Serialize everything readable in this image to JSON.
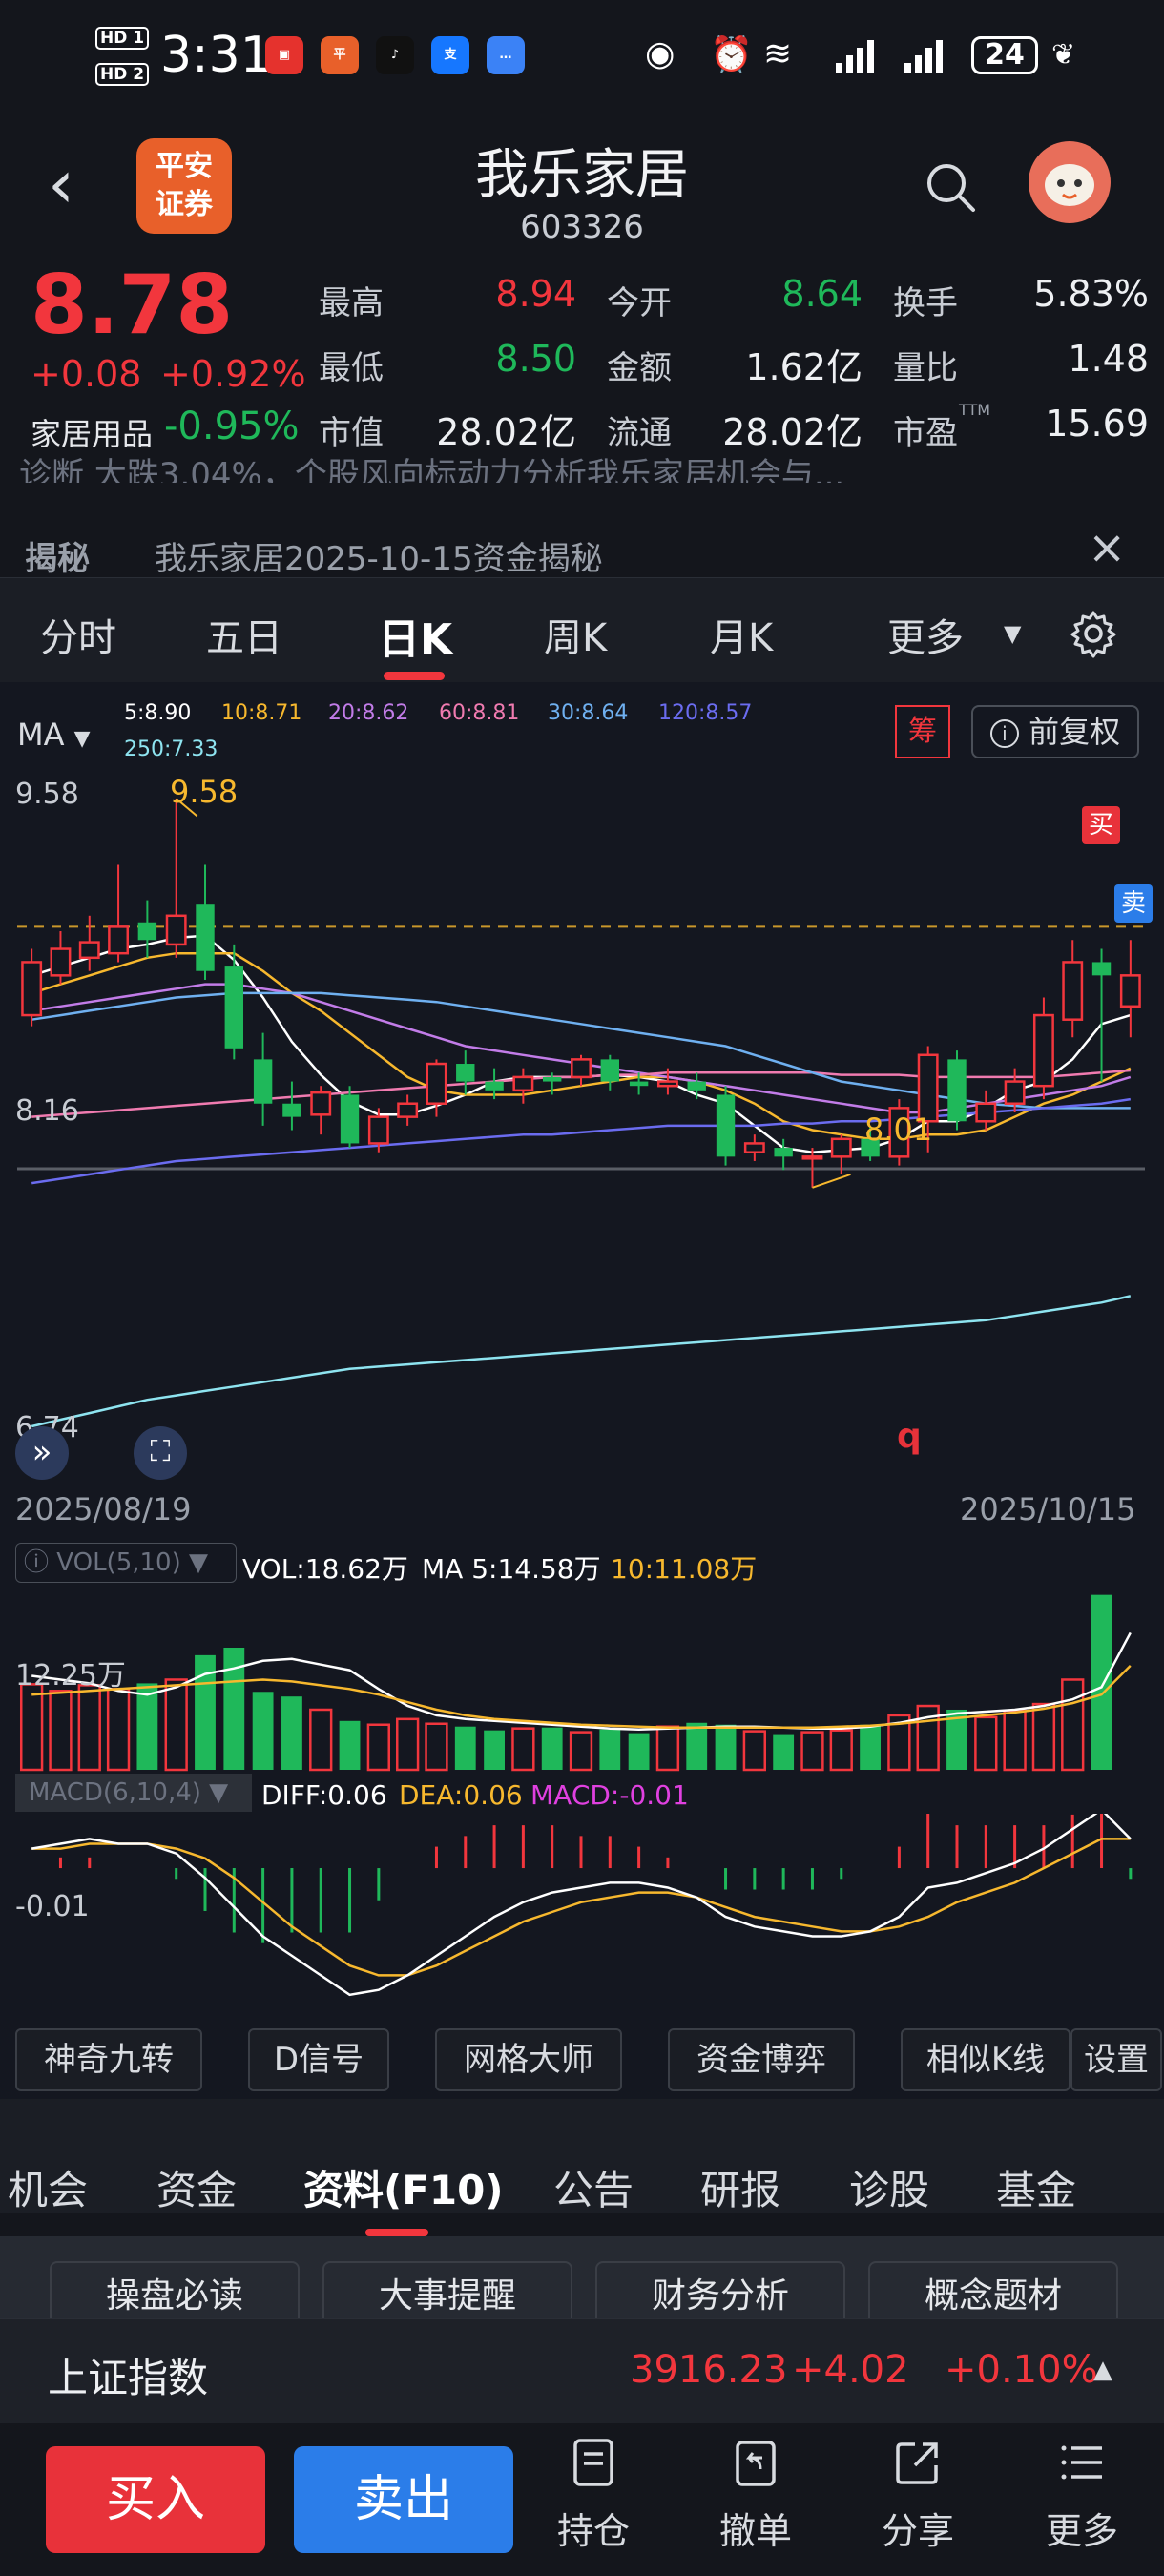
{
  "status": {
    "time": "3:31",
    "battery": "24",
    "hd1": "HD 1",
    "hd2": "HD 2",
    "app_icons": [
      "huawei-store-icon",
      "pingan-app-icon",
      "douyin-icon",
      "alipay-icon",
      "message-icon"
    ],
    "sys_icons": [
      "eye-icon",
      "alarm-icon",
      "wifi-icon",
      "signal-icon",
      "signal-icon",
      "leaf-icon"
    ]
  },
  "header": {
    "logo": "平安\n证券",
    "name": "我乐家居",
    "code": "603326"
  },
  "quote": {
    "price": "8.78",
    "change": "+0.08",
    "change_pct": "+0.92%",
    "industry": "家居用品",
    "industry_pct": "-0.95%",
    "fields": [
      {
        "label": "最高",
        "value": "8.94",
        "color": "red"
      },
      {
        "label": "今开",
        "value": "8.64",
        "color": "green"
      },
      {
        "label": "换手",
        "value": "5.83%",
        "color": "white"
      },
      {
        "label": "最低",
        "value": "8.50",
        "color": "green"
      },
      {
        "label": "金额",
        "value": "1.62亿",
        "color": "white"
      },
      {
        "label": "量比",
        "value": "1.48",
        "color": "white"
      },
      {
        "label": "市值",
        "value": "28.02亿",
        "color": "white"
      },
      {
        "label": "流通",
        "value": "28.02亿",
        "color": "white"
      },
      {
        "label": "市盈",
        "value": "15.69",
        "color": "white"
      }
    ],
    "ttm": "TTM"
  },
  "ticker": "诊断    大跌3.04%，个股风向标动力分析我乐家居机会与...",
  "notice": {
    "tag": "揭秘",
    "text": "我乐家居2025-10-15资金揭秘"
  },
  "tabs": {
    "items": [
      "分时",
      "五日",
      "日K",
      "周K",
      "月K",
      "更多"
    ],
    "active": "日K"
  },
  "ma": {
    "selector": "MA",
    "items": [
      {
        "label": "5:8.90",
        "color": "#ffffff"
      },
      {
        "label": "10:8.71",
        "color": "#f7b82e"
      },
      {
        "label": "20:8.62",
        "color": "#c27ce8"
      },
      {
        "label": "60:8.81",
        "color": "#f07bb0"
      },
      {
        "label": "30:8.64",
        "color": "#6fb0f0"
      },
      {
        "label": "120:8.57",
        "color": "#6b6cf0"
      },
      {
        "label": "250:7.33",
        "color": "#8ee4f0"
      }
    ],
    "chou": "筹",
    "fuquan": "前复权"
  },
  "kline": {
    "y_top": "9.58",
    "y_mid": "8.16",
    "y_low": "6.74",
    "high_label": "9.58",
    "low_label": "8.01",
    "buy_tag": "买",
    "sell_tag": "卖",
    "q": "q",
    "date_start": "2025/08/19",
    "date_end": "2025/10/15"
  },
  "chart_data": {
    "type": "candlestick",
    "candles": [
      {
        "o": 8.6,
        "c": 8.84,
        "h": 8.9,
        "l": 8.55
      },
      {
        "o": 8.78,
        "c": 8.9,
        "h": 8.98,
        "l": 8.74
      },
      {
        "o": 8.86,
        "c": 8.93,
        "h": 9.05,
        "l": 8.8
      },
      {
        "o": 8.88,
        "c": 9.0,
        "h": 9.28,
        "l": 8.84
      },
      {
        "o": 9.02,
        "c": 8.94,
        "h": 9.12,
        "l": 8.86
      },
      {
        "o": 8.92,
        "c": 9.05,
        "h": 9.58,
        "l": 8.86
      },
      {
        "o": 9.1,
        "c": 8.8,
        "h": 9.28,
        "l": 8.76
      },
      {
        "o": 8.82,
        "c": 8.45,
        "h": 8.92,
        "l": 8.4
      },
      {
        "o": 8.4,
        "c": 8.2,
        "h": 8.52,
        "l": 8.1
      },
      {
        "o": 8.2,
        "c": 8.14,
        "h": 8.3,
        "l": 8.08
      },
      {
        "o": 8.15,
        "c": 8.25,
        "h": 8.28,
        "l": 8.06
      },
      {
        "o": 8.24,
        "c": 8.02,
        "h": 8.28,
        "l": 8.0
      },
      {
        "o": 8.02,
        "c": 8.14,
        "h": 8.18,
        "l": 7.98
      },
      {
        "o": 8.14,
        "c": 8.2,
        "h": 8.24,
        "l": 8.1
      },
      {
        "o": 8.2,
        "c": 8.38,
        "h": 8.4,
        "l": 8.14
      },
      {
        "o": 8.38,
        "c": 8.3,
        "h": 8.44,
        "l": 8.24
      },
      {
        "o": 8.3,
        "c": 8.26,
        "h": 8.36,
        "l": 8.22
      },
      {
        "o": 8.26,
        "c": 8.32,
        "h": 8.36,
        "l": 8.2
      },
      {
        "o": 8.32,
        "c": 8.3,
        "h": 8.34,
        "l": 8.24
      },
      {
        "o": 8.32,
        "c": 8.4,
        "h": 8.42,
        "l": 8.28
      },
      {
        "o": 8.4,
        "c": 8.3,
        "h": 8.42,
        "l": 8.26
      },
      {
        "o": 8.3,
        "c": 8.28,
        "h": 8.34,
        "l": 8.24
      },
      {
        "o": 8.28,
        "c": 8.3,
        "h": 8.36,
        "l": 8.24
      },
      {
        "o": 8.3,
        "c": 8.26,
        "h": 8.34,
        "l": 8.22
      },
      {
        "o": 8.24,
        "c": 7.96,
        "h": 8.28,
        "l": 7.92
      },
      {
        "o": 7.98,
        "c": 8.02,
        "h": 8.06,
        "l": 7.94
      },
      {
        "o": 8.0,
        "c": 7.96,
        "h": 8.04,
        "l": 7.9
      },
      {
        "o": 7.96,
        "c": 7.96,
        "h": 8.0,
        "l": 7.82
      },
      {
        "o": 7.96,
        "c": 8.04,
        "h": 8.06,
        "l": 7.88
      },
      {
        "o": 8.04,
        "c": 7.96,
        "h": 8.1,
        "l": 7.94
      },
      {
        "o": 7.96,
        "c": 8.18,
        "h": 8.22,
        "l": 7.92
      },
      {
        "o": 8.12,
        "c": 8.42,
        "h": 8.46,
        "l": 7.98
      },
      {
        "o": 8.4,
        "c": 8.12,
        "h": 8.44,
        "l": 8.08
      },
      {
        "o": 8.12,
        "c": 8.2,
        "h": 8.26,
        "l": 8.08
      },
      {
        "o": 8.2,
        "c": 8.3,
        "h": 8.36,
        "l": 8.16
      },
      {
        "o": 8.28,
        "c": 8.6,
        "h": 8.68,
        "l": 8.22
      },
      {
        "o": 8.58,
        "c": 8.84,
        "h": 8.94,
        "l": 8.5
      },
      {
        "o": 8.84,
        "c": 8.78,
        "h": 8.9,
        "l": 8.3
      },
      {
        "o": 8.64,
        "c": 8.78,
        "h": 8.94,
        "l": 8.5
      }
    ],
    "ma_series": [
      {
        "name": "MA5",
        "color": "#ffffff",
        "values": [
          8.78,
          8.82,
          8.86,
          8.9,
          8.92,
          8.95,
          8.96,
          8.85,
          8.68,
          8.48,
          8.33,
          8.21,
          8.15,
          8.15,
          8.19,
          8.24,
          8.3,
          8.32,
          8.32,
          8.32,
          8.33,
          8.32,
          8.3,
          8.24,
          8.2,
          8.1,
          8.0,
          7.98,
          7.99,
          8.0,
          8.04,
          8.12,
          8.12,
          8.18,
          8.26,
          8.3,
          8.4,
          8.56,
          8.6
        ]
      },
      {
        "name": "MA10",
        "color": "#f7b82e",
        "values": [
          8.7,
          8.74,
          8.78,
          8.82,
          8.86,
          8.88,
          8.88,
          8.88,
          8.8,
          8.7,
          8.62,
          8.52,
          8.42,
          8.32,
          8.26,
          8.24,
          8.24,
          8.24,
          8.26,
          8.28,
          8.3,
          8.32,
          8.32,
          8.3,
          8.26,
          8.2,
          8.12,
          8.08,
          8.06,
          8.04,
          8.04,
          8.06,
          8.06,
          8.08,
          8.14,
          8.2,
          8.24,
          8.3,
          8.36
        ]
      },
      {
        "name": "MA20",
        "color": "#c27ce8",
        "values": [
          8.62,
          8.64,
          8.66,
          8.68,
          8.7,
          8.72,
          8.74,
          8.74,
          8.72,
          8.7,
          8.66,
          8.62,
          8.58,
          8.54,
          8.5,
          8.46,
          8.44,
          8.42,
          8.4,
          8.38,
          8.36,
          8.34,
          8.32,
          8.3,
          8.28,
          8.26,
          8.24,
          8.22,
          8.2,
          8.18,
          8.16,
          8.16,
          8.18,
          8.2,
          8.22,
          8.24,
          8.26,
          8.28,
          8.32
        ]
      },
      {
        "name": "MA60",
        "color": "#f07bb0",
        "values": [
          8.14,
          8.15,
          8.16,
          8.17,
          8.18,
          8.19,
          8.2,
          8.21,
          8.22,
          8.23,
          8.24,
          8.25,
          8.26,
          8.27,
          8.28,
          8.29,
          8.3,
          8.31,
          8.32,
          8.32,
          8.33,
          8.33,
          8.34,
          8.34,
          8.34,
          8.34,
          8.34,
          8.34,
          8.33,
          8.33,
          8.33,
          8.32,
          8.32,
          8.32,
          8.32,
          8.32,
          8.33,
          8.34,
          8.35
        ]
      },
      {
        "name": "MA30",
        "color": "#6fb0f0",
        "values": [
          8.58,
          8.6,
          8.62,
          8.64,
          8.66,
          8.68,
          8.69,
          8.7,
          8.7,
          8.7,
          8.7,
          8.69,
          8.68,
          8.67,
          8.66,
          8.64,
          8.62,
          8.6,
          8.58,
          8.56,
          8.54,
          8.52,
          8.5,
          8.48,
          8.46,
          8.42,
          8.38,
          8.34,
          8.3,
          8.28,
          8.26,
          8.24,
          8.22,
          8.2,
          8.19,
          8.18,
          8.18,
          8.18,
          8.18
        ]
      },
      {
        "name": "MA120",
        "color": "#6b6cf0",
        "values": [
          7.84,
          7.86,
          7.88,
          7.9,
          7.92,
          7.94,
          7.95,
          7.96,
          7.97,
          7.98,
          7.99,
          8.0,
          8.01,
          8.02,
          8.03,
          8.04,
          8.05,
          8.06,
          8.06,
          8.07,
          8.08,
          8.09,
          8.1,
          8.1,
          8.1,
          8.1,
          8.11,
          8.11,
          8.12,
          8.12,
          8.13,
          8.14,
          8.15,
          8.16,
          8.17,
          8.18,
          8.19,
          8.2,
          8.22
        ]
      },
      {
        "name": "MA250",
        "color": "#8ee4f0",
        "values": [
          6.74,
          6.77,
          6.8,
          6.83,
          6.86,
          6.88,
          6.9,
          6.92,
          6.94,
          6.96,
          6.98,
          7.0,
          7.01,
          7.02,
          7.03,
          7.04,
          7.05,
          7.06,
          7.07,
          7.08,
          7.09,
          7.1,
          7.11,
          7.12,
          7.13,
          7.14,
          7.15,
          7.16,
          7.17,
          7.18,
          7.19,
          7.2,
          7.21,
          7.22,
          7.24,
          7.26,
          7.28,
          7.3,
          7.33
        ]
      }
    ],
    "volume": [
      9.1,
      8.4,
      9.0,
      8.6,
      9.2,
      9.6,
      12.2,
      13.0,
      8.3,
      7.8,
      6.4,
      5.2,
      4.8,
      5.4,
      4.9,
      4.6,
      4.2,
      4.4,
      4.5,
      4.0,
      4.3,
      3.9,
      4.6,
      5.0,
      4.8,
      4.1,
      3.8,
      4.0,
      4.2,
      4.8,
      5.8,
      6.8,
      6.4,
      5.6,
      6.3,
      7.0,
      9.6,
      18.62
    ],
    "vol_ma5": [
      10.0,
      9.6,
      9.2,
      8.4,
      8.0,
      8.8,
      10.2,
      10.8,
      11.6,
      11.8,
      11.2,
      10.6,
      8.6,
      6.8,
      5.8,
      5.4,
      5.2,
      5.0,
      4.8,
      4.6,
      4.4,
      4.3,
      4.4,
      4.5,
      4.6,
      4.6,
      4.5,
      4.4,
      4.4,
      4.6,
      5.0,
      5.6,
      6.0,
      6.2,
      6.4,
      6.8,
      7.5,
      8.8,
      14.58
    ],
    "vol_ma10": [
      8.0,
      8.2,
      8.4,
      8.6,
      8.8,
      9.0,
      9.2,
      9.4,
      9.6,
      9.4,
      9.0,
      8.6,
      8.0,
      7.2,
      6.4,
      5.8,
      5.4,
      5.2,
      5.0,
      4.8,
      4.7,
      4.6,
      4.5,
      4.5,
      4.5,
      4.5,
      4.5,
      4.5,
      4.6,
      4.7,
      4.9,
      5.2,
      5.5,
      5.8,
      6.1,
      6.5,
      7.1,
      8.0,
      11.08
    ],
    "vol_ylabel": "12.25万",
    "macd_diff": [
      0.04,
      0.05,
      0.06,
      0.05,
      0.05,
      0.03,
      -0.02,
      -0.08,
      -0.14,
      -0.18,
      -0.22,
      -0.26,
      -0.25,
      -0.22,
      -0.18,
      -0.14,
      -0.1,
      -0.07,
      -0.05,
      -0.04,
      -0.03,
      -0.03,
      -0.04,
      -0.06,
      -0.1,
      -0.12,
      -0.13,
      -0.14,
      -0.14,
      -0.13,
      -0.1,
      -0.04,
      -0.03,
      -0.01,
      0.01,
      0.04,
      0.08,
      0.12,
      0.06
    ],
    "macd_dea": [
      0.04,
      0.04,
      0.05,
      0.05,
      0.05,
      0.04,
      0.02,
      -0.02,
      -0.07,
      -0.12,
      -0.16,
      -0.2,
      -0.22,
      -0.22,
      -0.2,
      -0.17,
      -0.14,
      -0.11,
      -0.09,
      -0.07,
      -0.06,
      -0.05,
      -0.05,
      -0.06,
      -0.08,
      -0.1,
      -0.11,
      -0.12,
      -0.13,
      -0.13,
      -0.12,
      -0.1,
      -0.07,
      -0.05,
      -0.03,
      0.0,
      0.03,
      0.06,
      0.06
    ],
    "macd_hist": [
      0.0,
      0.01,
      0.01,
      0.0,
      0.0,
      -0.01,
      -0.04,
      -0.06,
      -0.07,
      -0.06,
      -0.06,
      -0.06,
      -0.03,
      0.0,
      0.02,
      0.03,
      0.04,
      0.04,
      0.04,
      0.03,
      0.03,
      0.02,
      0.01,
      0.0,
      -0.02,
      -0.02,
      -0.02,
      -0.02,
      -0.01,
      0.0,
      0.02,
      0.06,
      0.04,
      0.04,
      0.04,
      0.04,
      0.05,
      0.06,
      -0.01
    ],
    "macd_ylabel": "-0.01"
  },
  "vol": {
    "selector": "VOL(5,10)",
    "vol": "VOL:18.62万",
    "ma5": "MA 5:14.58万",
    "ma10": "10:11.08万"
  },
  "macd": {
    "selector": "MACD(6,10,4)",
    "diff": "DIFF:0.06",
    "dea": "DEA:0.06",
    "macd": "MACD:-0.01"
  },
  "tools": [
    "神奇九转",
    "D信号",
    "网格大师",
    "资金博弈",
    "相似K线",
    "设置"
  ],
  "f10": {
    "tabs": [
      "机会",
      "资金",
      "资料(F10)",
      "公告",
      "研报",
      "诊股",
      "基金"
    ],
    "active": "资料(F10)",
    "sub": [
      "操盘必读",
      "大事提醒",
      "财务分析",
      "概念题材"
    ]
  },
  "index": {
    "name": "上证指数",
    "value": "3916.23",
    "change": "+4.02",
    "pct": "+0.10%"
  },
  "bottom": {
    "buy": "买入",
    "sell": "卖出",
    "nav": [
      "持仓",
      "撤单",
      "分享",
      "更多"
    ]
  }
}
